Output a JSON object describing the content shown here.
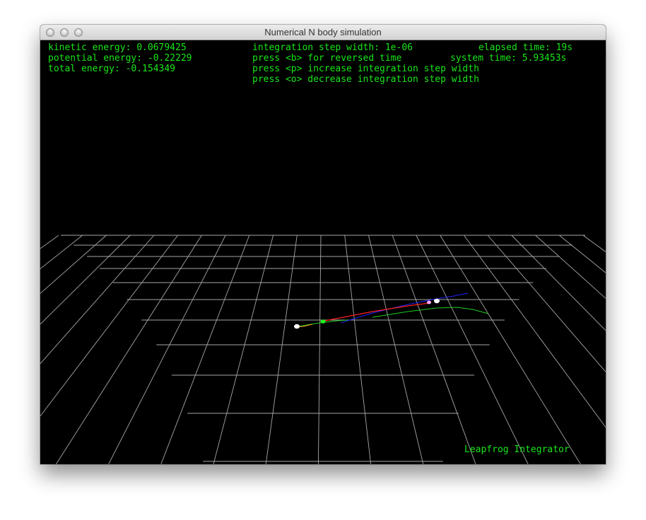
{
  "window": {
    "title": "Numerical N body simulation",
    "buttons": [
      "close",
      "minimize",
      "zoom"
    ]
  },
  "hud": {
    "energy": [
      "kinetic energy: 0.0679425",
      "potential energy: -0.22229",
      "total energy: -0.154349"
    ],
    "controls": [
      "integration step width: 1e-06",
      "press <b> for reversed time",
      "press <p> increase integration step width",
      "press <o> decrease integration step width"
    ],
    "time": [
      "elapsed time: 19s",
      "system time: 5.93453s"
    ],
    "integrator": "Leapfrog Integrator"
  },
  "colors": {
    "hud_text": "#19e619",
    "grid": "#a6a6a6",
    "background": "#000000",
    "body_white": "#ffffff",
    "body_green": "#22ee22",
    "body_pink": "#ffaaee",
    "trail_red": "#ff2020",
    "trail_blue": "#2222ff",
    "trail_green": "#22cc22",
    "trail_orange": "#ff9922"
  }
}
